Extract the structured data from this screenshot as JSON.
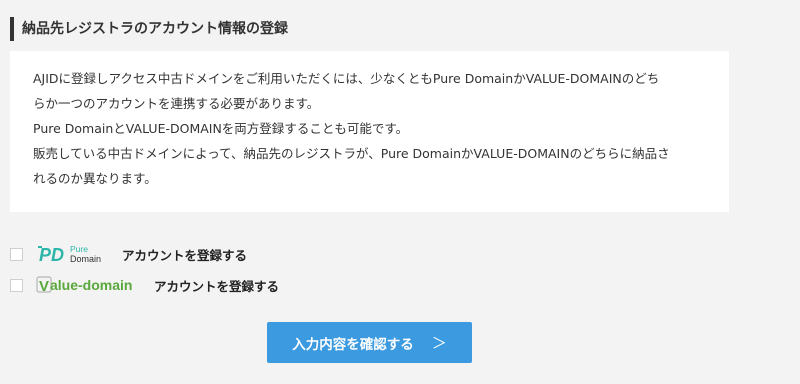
{
  "heading": "納品先レジストラのアカウント情報の登録",
  "info_lines": [
    "AJIDに登録しアクセス中古ドメインをご利用いただくには、少なくともPure DomainかVALUE-DOMAINのどち",
    "らか一つのアカウントを連携する必要があります。",
    "Pure DomainとVALUE-DOMAINを両方登録することも可能です。",
    "販売している中古ドメインによって、納品先のレジストラが、Pure DomainかVALUE-DOMAINのどちらに納品さ",
    "れるのか異なります。"
  ],
  "registrars": [
    {
      "logo_mark": "PD",
      "logo_text_line1": "Pure",
      "logo_text_line2": "Domain",
      "label": "アカウントを登録する",
      "checked": false,
      "color": "#2cb5a8"
    },
    {
      "logo_mark": "V",
      "logo_text": "alue-domain",
      "label": "アカウントを登録する",
      "checked": false,
      "color": "#5aa83c"
    }
  ],
  "confirm_button": {
    "label": "入力内容を確認する",
    "chevron": "＞",
    "color": "#3b9ae0"
  },
  "colors": {
    "page_background": "#f3f3f3",
    "box_background": "#ffffff",
    "text": "#333333"
  }
}
